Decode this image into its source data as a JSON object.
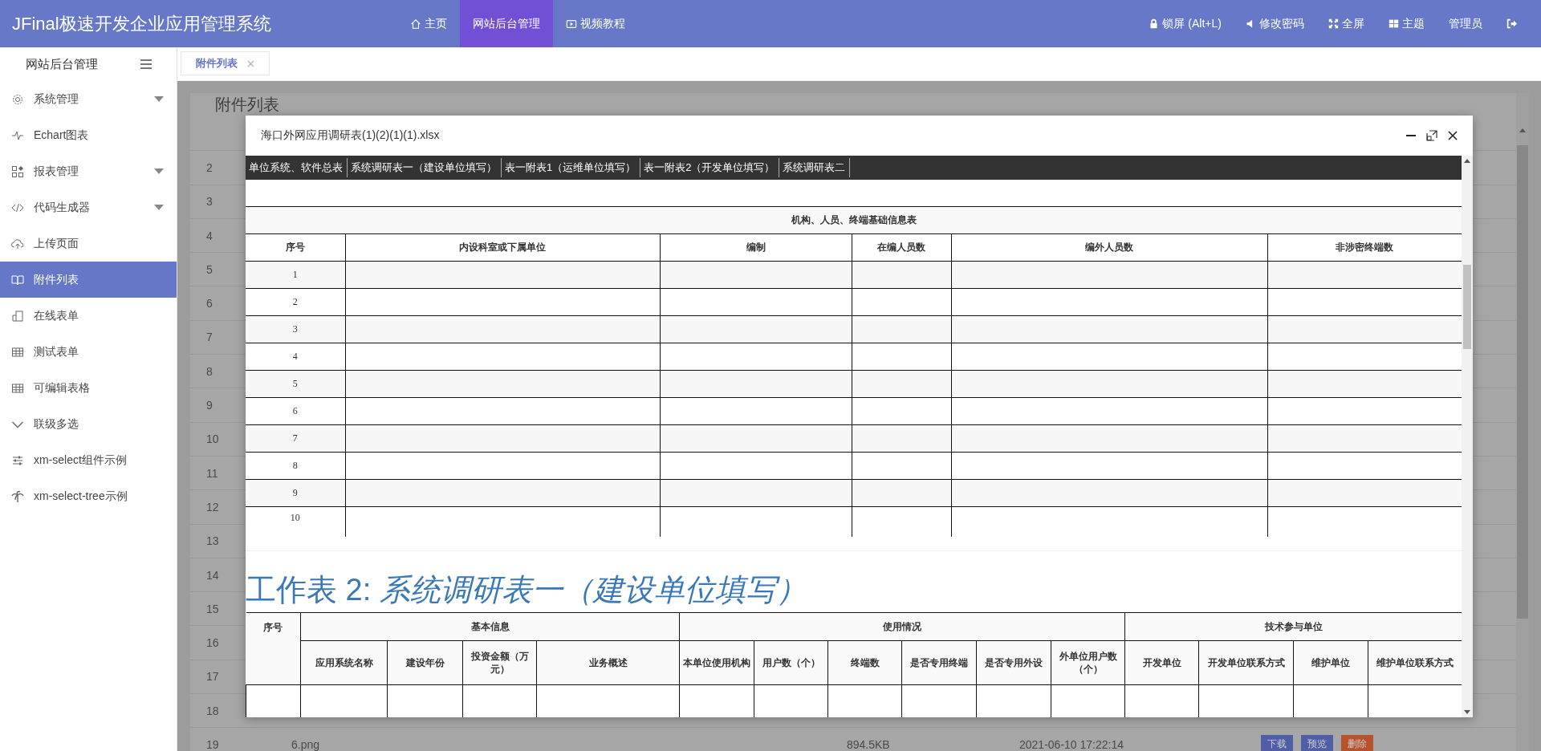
{
  "header": {
    "logo": "JFinal极速开发企业应用管理系统",
    "nav": [
      {
        "label": "主页",
        "selected": false
      },
      {
        "label": "网站后台管理",
        "selected": true
      },
      {
        "label": "视频教程",
        "selected": false
      }
    ],
    "tools": [
      "锁屏 (Alt+L)",
      "修改密码",
      "全屏",
      "主题",
      "管理员"
    ]
  },
  "sidebar": {
    "title": "网站后台管理",
    "items": [
      {
        "label": "系统管理",
        "expandable": true,
        "selected": false
      },
      {
        "label": "Echart图表",
        "expandable": false,
        "selected": false
      },
      {
        "label": "报表管理",
        "expandable": true,
        "selected": false
      },
      {
        "label": "代码生成器",
        "expandable": true,
        "selected": false
      },
      {
        "label": "上传页面",
        "expandable": false,
        "selected": false
      },
      {
        "label": "附件列表",
        "expandable": false,
        "selected": true
      },
      {
        "label": "在线表单",
        "expandable": false,
        "selected": false
      },
      {
        "label": "测试表单",
        "expandable": false,
        "selected": false
      },
      {
        "label": "可编辑表格",
        "expandable": false,
        "selected": false
      },
      {
        "label": "联级多选",
        "expandable": false,
        "selected": false
      },
      {
        "label": "xm-select组件示例",
        "expandable": false,
        "selected": false
      },
      {
        "label": "xm-select-tree示例",
        "expandable": false,
        "selected": false
      }
    ]
  },
  "tabs": [
    {
      "label": "附件列表",
      "selected": true
    }
  ],
  "page": {
    "title": "附件列表",
    "rows": [
      {
        "no": "2"
      },
      {
        "no": "3"
      },
      {
        "no": "4"
      },
      {
        "no": "5"
      },
      {
        "no": "6"
      },
      {
        "no": "7"
      },
      {
        "no": "8"
      },
      {
        "no": "9"
      },
      {
        "no": "10"
      },
      {
        "no": "11"
      },
      {
        "no": "12"
      },
      {
        "no": "13"
      },
      {
        "no": "14"
      },
      {
        "no": "15"
      },
      {
        "no": "16"
      },
      {
        "no": "17"
      },
      {
        "no": "18"
      },
      {
        "no": "19",
        "name": "6.png",
        "size": "894.5KB",
        "time": "2021-06-10 17:22:14",
        "actions": [
          {
            "label": "下载",
            "color": "#4f5ea6"
          },
          {
            "label": "预览",
            "color": "#4f5ea6"
          },
          {
            "label": "删除",
            "color": "#b8522c"
          }
        ]
      }
    ]
  },
  "dialog": {
    "title": "海口外网应用调研表(1)(2)(1)(1).xlsx",
    "sheet_tabs": [
      "单位系统、软件总表",
      "系统调研表一（建设单位填写）",
      "表一附表1（运维单位填写）",
      "表一附表2（开发单位填写）",
      "系统调研表二"
    ],
    "table1": {
      "title": "机构、人员、终端基础信息表",
      "columns": [
        "序号",
        "内设科室或下属单位",
        "编制",
        "在编人员数",
        "编外人员数",
        "非涉密终端数"
      ],
      "rows": [
        "1",
        "2",
        "3",
        "4",
        "5",
        "6",
        "7",
        "8",
        "9",
        "10"
      ]
    },
    "sheet2_heading": "工作表 2: *系统调研表一（建设单位填写）*",
    "table2": {
      "index_column": "序号",
      "groups": [
        {
          "label": "基本信息",
          "columns": [
            "应用系统名称",
            "建设年份",
            "投资金额（万元）",
            "业务概述"
          ]
        },
        {
          "label": "使用情况",
          "columns": [
            "本单位使用机构",
            "用户数（个）",
            "终端数",
            "是否专用终端",
            "是否专用外设",
            "外单位用户数（个）"
          ]
        },
        {
          "label": "技术参与单位",
          "columns": [
            "开发单位",
            "开发单位联系方式",
            "维护单位",
            "维护单位联系方式"
          ]
        }
      ]
    }
  }
}
